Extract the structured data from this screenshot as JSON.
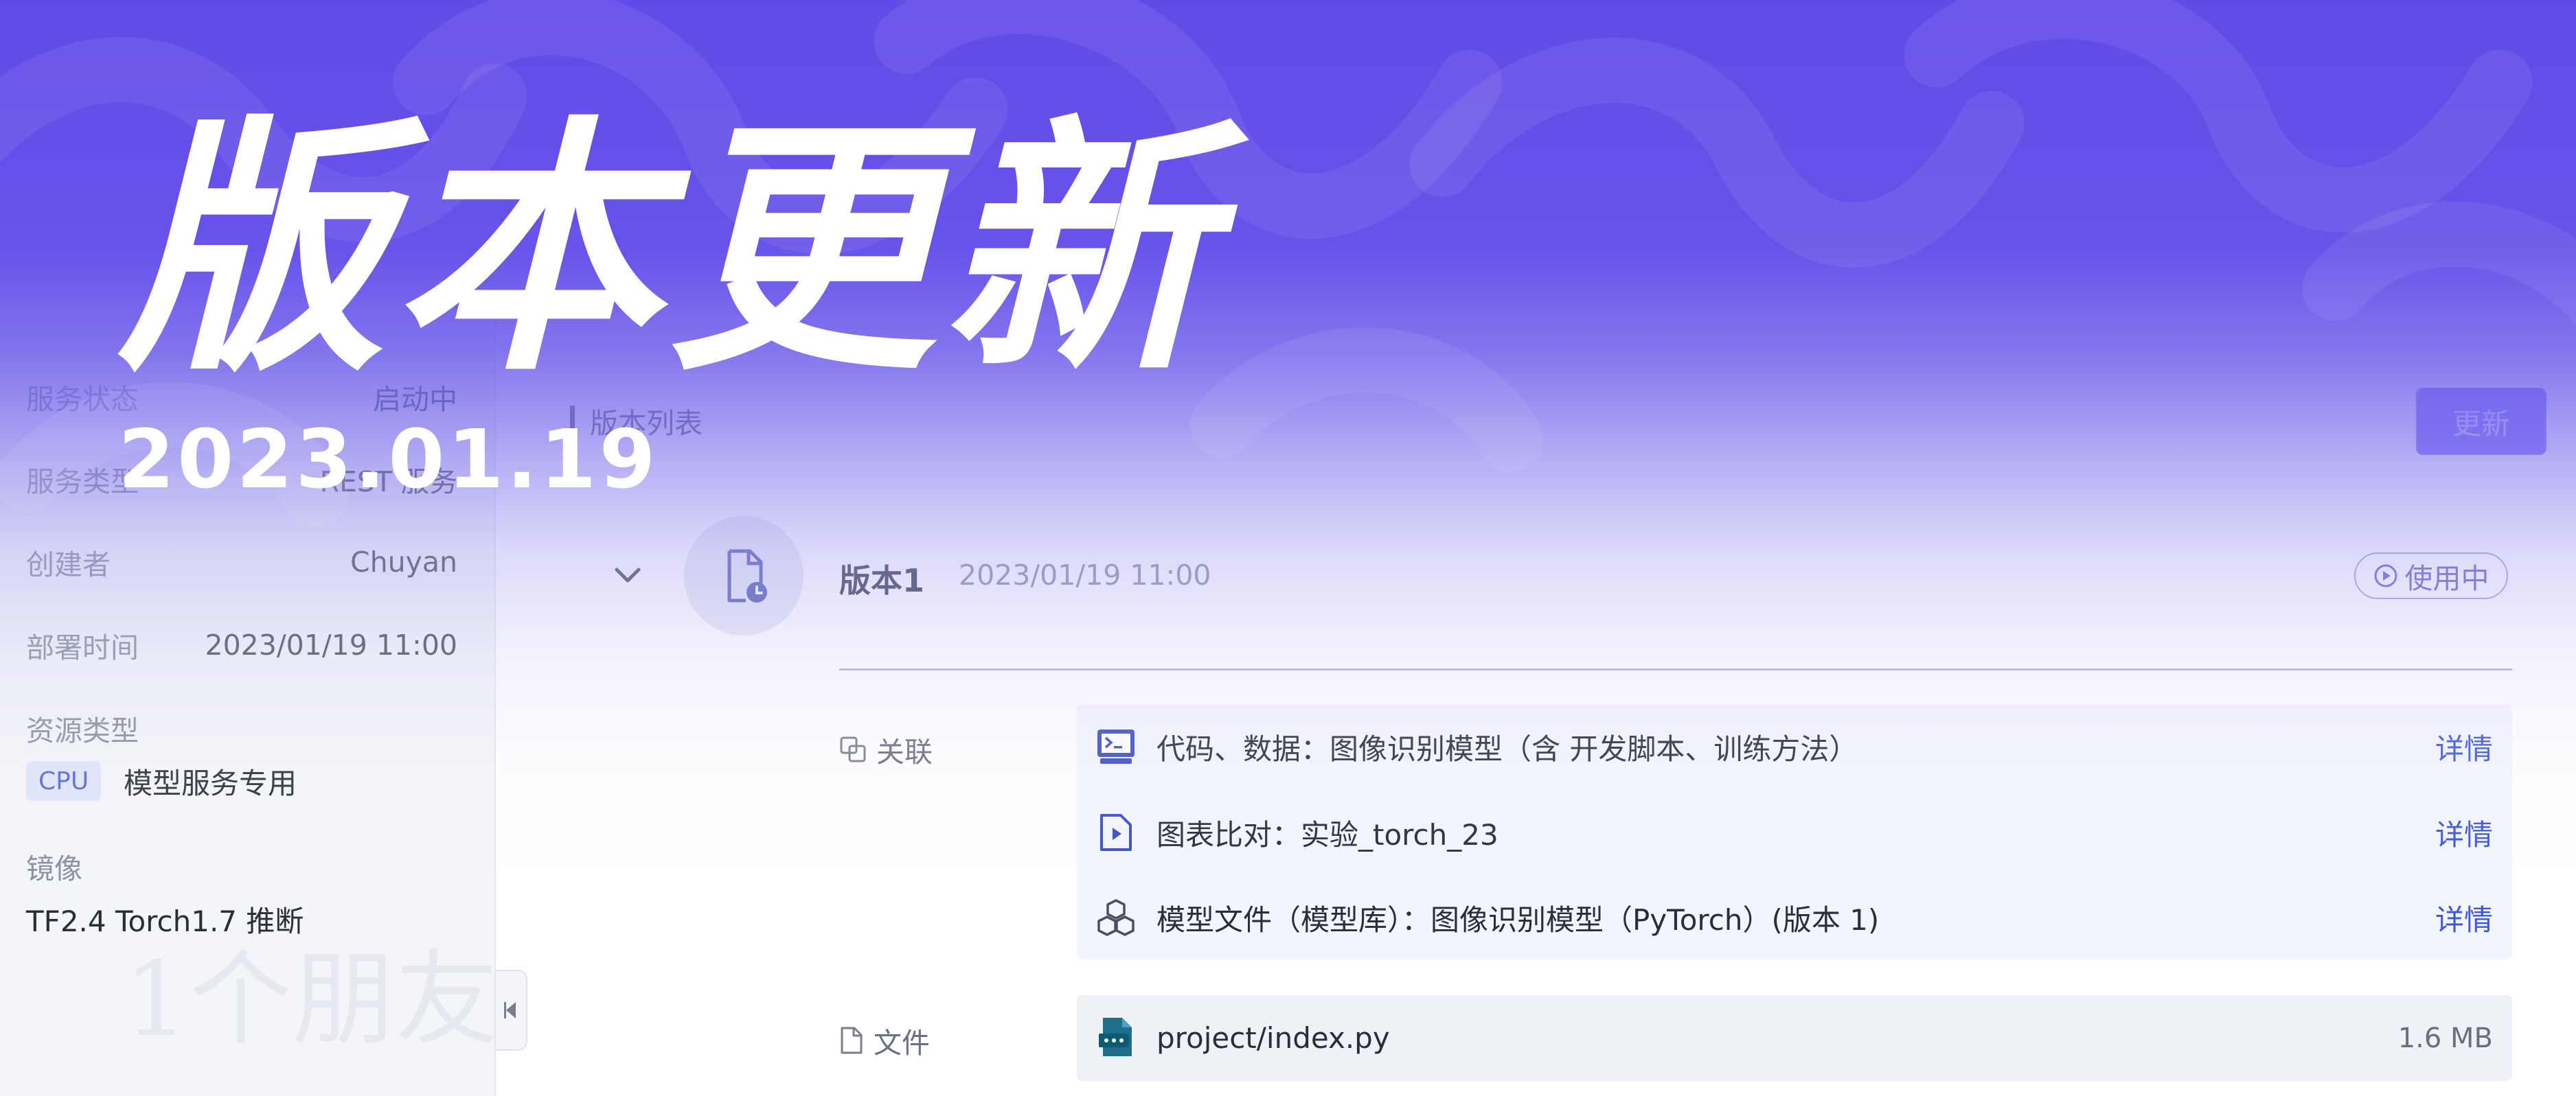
{
  "banner": {
    "title": "版本更新",
    "date": "2023.01.19",
    "watermark": "1个朋友",
    "color": "#614be8"
  },
  "sidebar": {
    "rows": [
      {
        "key": "服务状态",
        "value": "启动中"
      },
      {
        "key": "服务类型",
        "value": "REST 服务"
      },
      {
        "key": "创建者",
        "value": "Chuyan"
      },
      {
        "key": "部署时间",
        "value": "2023/01/19 11:00"
      }
    ],
    "resource_type_label": "资源类型",
    "cpu_tag": "CPU",
    "resource_desc": "模型服务专用",
    "mirror_label": "镜像",
    "mirror_value": "TF2.4 Torch1.7 推断"
  },
  "main": {
    "list_title": "版本列表",
    "update_button": "更新",
    "version": {
      "name": "版本1",
      "time": "2023/01/19 11:00",
      "status": "使用中"
    },
    "relations": {
      "label": "关联",
      "items": [
        {
          "text": "代码、数据：图像识别模型（含 开发脚本、训练方法）",
          "link": "详情",
          "icon": "terminal-icon"
        },
        {
          "text": "图表比对：实验_torch_23",
          "link": "详情",
          "icon": "chart-file-icon"
        },
        {
          "text": "模型文件（模型库）：图像识别模型（PyTorch）(版本 1)",
          "link": "详情",
          "icon": "cubes-icon"
        }
      ]
    },
    "files": {
      "label": "文件",
      "items": [
        {
          "name": "project/index.py",
          "size": "1.6 MB",
          "icon": "python-file-icon"
        }
      ]
    }
  },
  "colors": {
    "accent": "#3e56d8",
    "tag_bg": "#e2e6fb",
    "banner_purple": "#614be8"
  }
}
